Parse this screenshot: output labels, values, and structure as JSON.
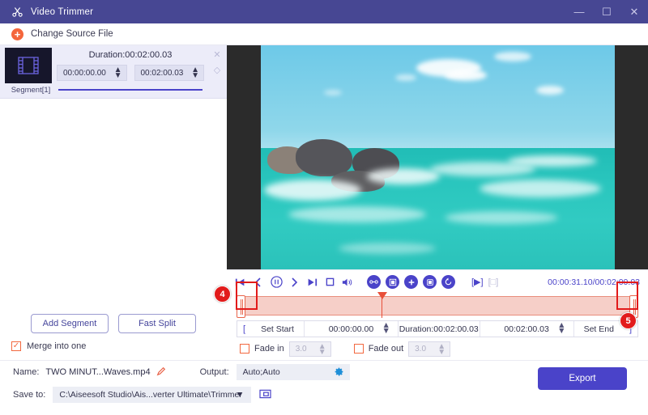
{
  "window": {
    "title": "Video Trimmer",
    "icon": "scissors-icon",
    "minimize": "—",
    "maximize": "☐",
    "close": "✕",
    "accent": "#474793",
    "primary": "#4a43c9",
    "orange": "#f4663c"
  },
  "source_bar": {
    "label": "Change Source File",
    "icon": "plus-circle-icon"
  },
  "segment": {
    "duration_label": "Duration:00:02:00.03",
    "start_time": "00:00:00.00",
    "end_time": "00:02:00.03",
    "name": "Segment[1]",
    "close": "✕",
    "collapse": "◇",
    "thumb_icon": "film-strip-icon"
  },
  "left_actions": {
    "add_segment": "Add Segment",
    "fast_split": "Fast Split",
    "merge_label": "Merge into one",
    "merge_checked": true,
    "check_glyph": "✓"
  },
  "player": {
    "controls": [
      {
        "name": "skip-to-start-icon",
        "glyph": "❙▷"
      },
      {
        "name": "previous-frame-icon",
        "glyph": "‹"
      },
      {
        "name": "pause-icon",
        "glyph": "‖"
      },
      {
        "name": "next-frame-icon",
        "glyph": "›"
      },
      {
        "name": "skip-to-end-icon",
        "glyph": "◁❙"
      },
      {
        "name": "stop-icon",
        "glyph": "□"
      },
      {
        "name": "volume-icon",
        "glyph": "🔊"
      }
    ],
    "tools": [
      {
        "name": "split-icon",
        "glyph": "⦂"
      },
      {
        "name": "crop-icon",
        "glyph": "▣"
      },
      {
        "name": "add-icon",
        "glyph": "＋"
      },
      {
        "name": "record-icon",
        "glyph": "■"
      },
      {
        "name": "reset-icon",
        "glyph": "↺"
      }
    ],
    "preview_play": "[▶]",
    "preview_stop": "[□]",
    "time_display": "00:00:31.10/00:02:00.03"
  },
  "trim": {
    "set_start_label": "Set Start",
    "set_end_label": "Set End",
    "start_bracket": "[",
    "end_bracket": "]",
    "start_value": "00:00:00.00",
    "end_value": "00:02:00.03",
    "duration_label": "Duration:00:02:00.03"
  },
  "fade": {
    "in_label": "Fade in",
    "out_label": "Fade out",
    "in_value": "3.0",
    "out_value": "3.0",
    "in_checked": false,
    "out_checked": false
  },
  "output": {
    "name_label": "Name:",
    "name_value": "TWO MINUT...Waves.mp4",
    "edit_icon": "pencil-icon",
    "output_label": "Output:",
    "output_value": "Auto;Auto",
    "gear_icon": "gear-icon",
    "saveto_label": "Save to:",
    "saveto_value": "C:\\Aiseesoft Studio\\Ais...verter Ultimate\\Trimmer",
    "folder_icon": "folder-open-icon",
    "export_label": "Export"
  },
  "annotations": [
    {
      "number": "4",
      "target": "left-trim-handle"
    },
    {
      "number": "5",
      "target": "right-trim-handle"
    }
  ]
}
